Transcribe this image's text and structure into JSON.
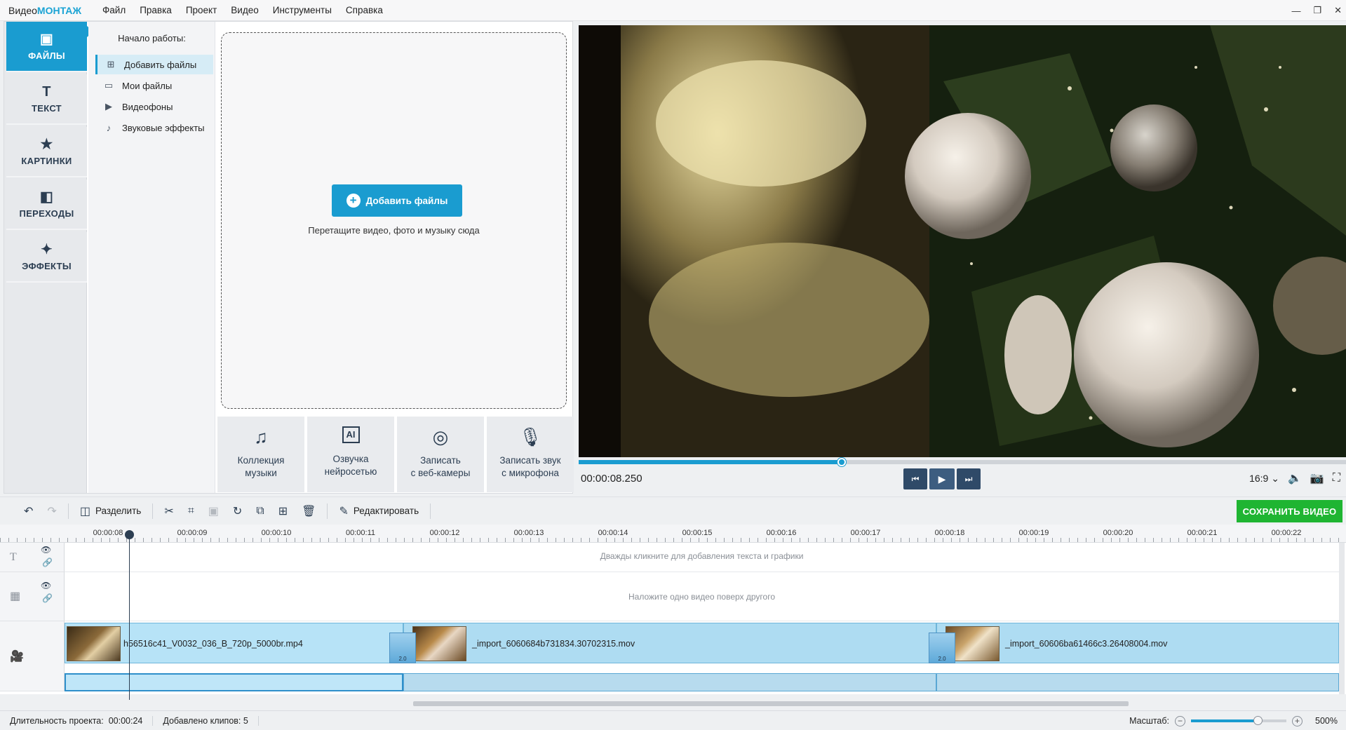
{
  "app": {
    "title_prefix": "Видео",
    "title_accent": "МОНТАЖ",
    "menu": [
      "Файл",
      "Правка",
      "Проект",
      "Видео",
      "Инструменты",
      "Справка"
    ],
    "window_controls": [
      "—",
      "❐",
      "✕"
    ]
  },
  "sidebar": {
    "tabs": [
      {
        "label": "ФАЙЛЫ",
        "icon": "files-icon",
        "glyph": "▣",
        "active": true
      },
      {
        "label": "ТЕКСТ",
        "icon": "text-icon",
        "glyph": "T",
        "active": false
      },
      {
        "label": "КАРТИНКИ",
        "icon": "star-icon",
        "glyph": "★",
        "active": false
      },
      {
        "label": "ПЕРЕХОДЫ",
        "icon": "transitions-icon",
        "glyph": "◧",
        "active": false
      },
      {
        "label": "ЭФФЕКТЫ",
        "icon": "magic-wand-icon",
        "glyph": "✦",
        "active": false
      }
    ]
  },
  "subnav": {
    "title": "Начало работы:",
    "items": [
      {
        "label": "Добавить файлы",
        "glyph": "⊞",
        "active": true
      },
      {
        "label": "Мои файлы",
        "glyph": "▭",
        "active": false
      },
      {
        "label": "Видеофоны",
        "glyph": "▶",
        "active": false
      },
      {
        "label": "Звуковые эффекты",
        "glyph": "♪",
        "active": false
      }
    ]
  },
  "dropzone": {
    "button_label": "Добавить файлы",
    "hint": "Перетащите видео, фото и музыку сюда"
  },
  "tiles": [
    {
      "line1": "Коллекция",
      "line2": "музыки",
      "icon": "music-notes-icon",
      "glyph": "♫"
    },
    {
      "line1": "Озвучка",
      "line2": "нейросетью",
      "icon": "ai-chip-icon",
      "glyph": "AI"
    },
    {
      "line1": "Записать",
      "line2": "с веб-камеры",
      "icon": "webcam-icon",
      "glyph": "◎"
    },
    {
      "line1": "Записать звук",
      "line2": "с микрофона",
      "icon": "microphone-icon",
      "glyph": "🎙"
    }
  ],
  "player": {
    "timecode": "00:00:08.250",
    "progress_fraction": 0.343,
    "aspect": "16:9 ⌄"
  },
  "toolbar": {
    "split_label": "Разделить",
    "edit_label": "Редактировать",
    "save_label": "СОХРАНИТЬ ВИДЕО"
  },
  "ruler": {
    "labels": [
      "00:00:08",
      "00:00:09",
      "00:00:10",
      "00:00:11",
      "00:00:12",
      "00:00:13",
      "00:00:14",
      "00:00:15",
      "00:00:16",
      "00:00:17",
      "00:00:18",
      "00:00:19",
      "00:00:20",
      "00:00:21",
      "00:00:22"
    ]
  },
  "timeline": {
    "text_hint": "Дважды кликните для добавления текста и графики",
    "overlay_hint": "Наложите одно видео поверх другого",
    "clips": [
      {
        "name": "h56516c41_V0032_036_B_720p_5000br.mp4"
      },
      {
        "name": "_import_6060684b731834.30702315.mov"
      },
      {
        "name": "_import_60606ba61466c3.26408004.mov"
      }
    ],
    "transition_value": "2.0"
  },
  "status": {
    "duration_label": "Длительность проекта:",
    "duration_value": "00:00:24",
    "clips_label": "Добавлено клипов: 5",
    "zoom_label": "Масштаб:",
    "zoom_value": "500%",
    "zoom_fraction": 0.7
  },
  "colors": {
    "accent": "#1a9cd0",
    "save_green": "#1fb532",
    "navy": "#2c3e52"
  }
}
